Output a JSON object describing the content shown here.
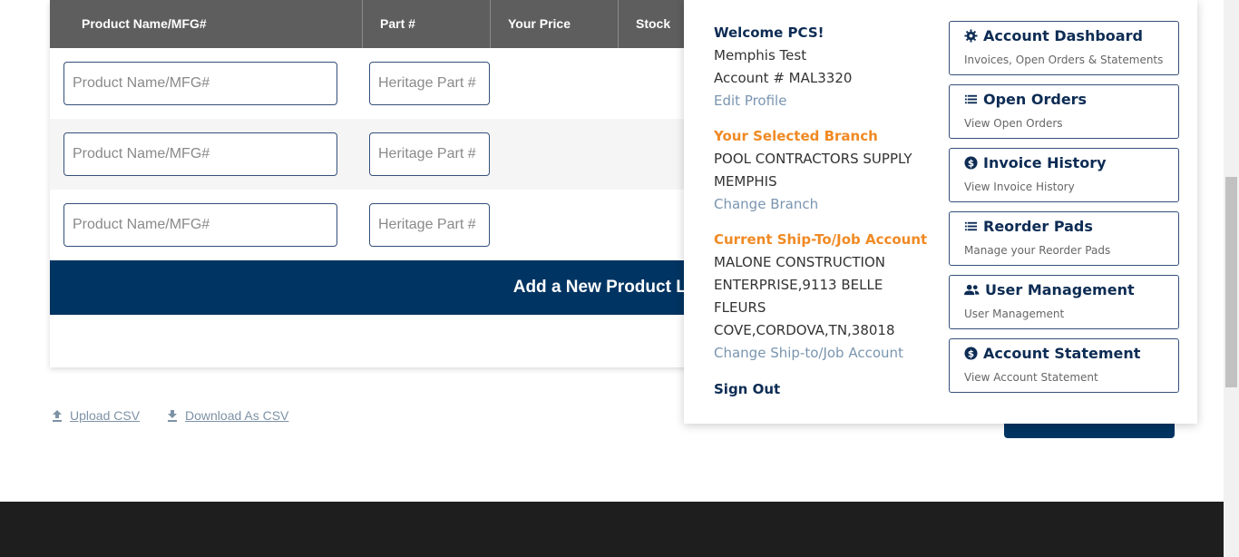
{
  "table": {
    "headers": [
      "Product Name/MFG#",
      "Part #",
      "Your Price",
      "Stock"
    ],
    "rows": [
      {
        "name_placeholder": "Product Name/MFG#",
        "part_placeholder": "Heritage Part #"
      },
      {
        "name_placeholder": "Product Name/MFG#",
        "part_placeholder": "Heritage Part #"
      },
      {
        "name_placeholder": "Product Name/MFG#",
        "part_placeholder": "Heritage Part #"
      }
    ],
    "add_line_label": "Add a New Product Line"
  },
  "csv": {
    "upload_label": "Upload CSV",
    "download_label": "Download As CSV"
  },
  "account_menu": {
    "welcome": "Welcome PCS!",
    "user_name": "Memphis Test",
    "account_number": "Account # MAL3320",
    "edit_profile": "Edit Profile",
    "branch_title": "Your Selected Branch",
    "branch_line1": "POOL CONTRACTORS SUPPLY",
    "branch_line2": "MEMPHIS",
    "change_branch": "Change Branch",
    "shipto_title": "Current Ship-To/Job Account",
    "shipto_line1": "MALONE CONSTRUCTION",
    "shipto_line2": "ENTERPRISE,9113 BELLE",
    "shipto_line3": "FLEURS",
    "shipto_line4": "COVE,CORDOVA,TN,38018",
    "change_shipto": "Change Ship-to/Job Account",
    "sign_out": "Sign Out",
    "items": [
      {
        "icon": "gear-icon",
        "title": "Account Dashboard",
        "subtitle": "Invoices, Open Orders & Statements"
      },
      {
        "icon": "list-icon",
        "title": "Open Orders",
        "subtitle": "View Open Orders"
      },
      {
        "icon": "dollar-icon",
        "title": "Invoice History",
        "subtitle": "View Invoice History"
      },
      {
        "icon": "list-icon",
        "title": "Reorder Pads",
        "subtitle": "Manage your Reorder Pads"
      },
      {
        "icon": "users-icon",
        "title": "User Management",
        "subtitle": "User Management"
      },
      {
        "icon": "dollar-icon",
        "title": "Account Statement",
        "subtitle": "View Account Statement"
      }
    ]
  },
  "colors": {
    "navy": "#003462",
    "header_gray": "#5e5e5e",
    "orange": "#f08a24",
    "link": "#7a95b0"
  }
}
